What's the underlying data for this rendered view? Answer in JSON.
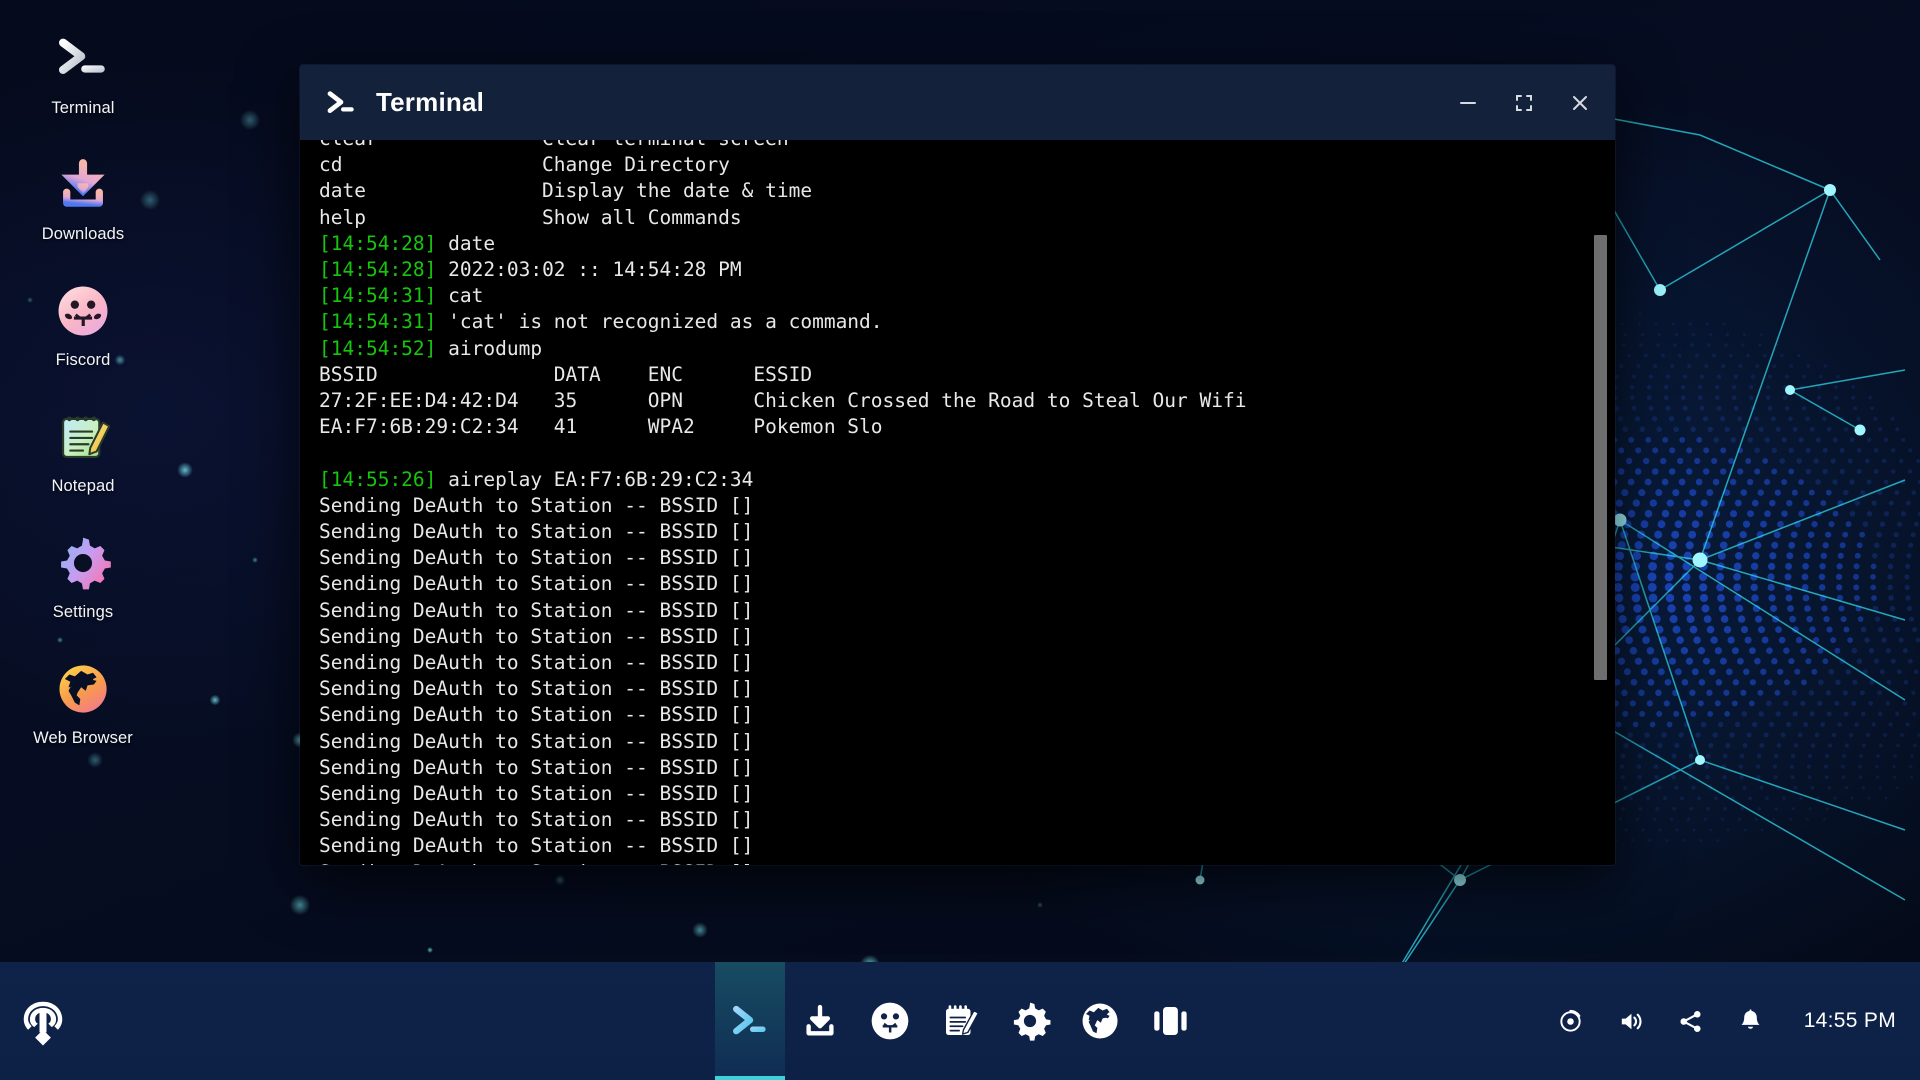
{
  "desktop": {
    "icons": [
      {
        "label": "Terminal",
        "icon": "terminal-prompt-icon"
      },
      {
        "label": "Downloads",
        "icon": "download-arrow-icon"
      },
      {
        "label": "Fiscord",
        "icon": "fiscord-face-icon"
      },
      {
        "label": "Notepad",
        "icon": "notepad-pencil-icon"
      },
      {
        "label": "Settings",
        "icon": "gear-icon"
      },
      {
        "label": "Web Browser",
        "icon": "globe-icon"
      }
    ]
  },
  "terminal": {
    "title": "Terminal",
    "title_icon": "terminal-prompt-icon",
    "controls": {
      "minimize": "minimize-icon",
      "maximize": "maximize-icon",
      "close": "close-icon"
    },
    "lines": [
      {
        "ts": "",
        "text": "clear              Clear terminal screen"
      },
      {
        "ts": "",
        "text": "cd                 Change Directory"
      },
      {
        "ts": "",
        "text": "date               Display the date & time"
      },
      {
        "ts": "",
        "text": "help               Show all Commands"
      },
      {
        "ts": "[14:54:28]",
        "text": " date"
      },
      {
        "ts": "[14:54:28]",
        "text": " 2022:03:02 :: 14:54:28 PM"
      },
      {
        "ts": "[14:54:31]",
        "text": " cat"
      },
      {
        "ts": "[14:54:31]",
        "text": " 'cat' is not recognized as a command."
      },
      {
        "ts": "[14:54:52]",
        "text": " airodump"
      },
      {
        "ts": "",
        "text": "BSSID               DATA    ENC      ESSID"
      },
      {
        "ts": "",
        "text": "27:2F:EE:D4:42:D4   35      OPN      Chicken Crossed the Road to Steal Our Wifi"
      },
      {
        "ts": "",
        "text": "EA:F7:6B:29:C2:34   41      WPA2     Pokemon Slo"
      },
      {
        "ts": "",
        "text": ""
      },
      {
        "ts": "[14:55:26]",
        "text": " aireplay EA:F7:6B:29:C2:34"
      },
      {
        "ts": "",
        "text": "Sending DeAuth to Station -- BSSID []"
      },
      {
        "ts": "",
        "text": "Sending DeAuth to Station -- BSSID []"
      },
      {
        "ts": "",
        "text": "Sending DeAuth to Station -- BSSID []"
      },
      {
        "ts": "",
        "text": "Sending DeAuth to Station -- BSSID []"
      },
      {
        "ts": "",
        "text": "Sending DeAuth to Station -- BSSID []"
      },
      {
        "ts": "",
        "text": "Sending DeAuth to Station -- BSSID []"
      },
      {
        "ts": "",
        "text": "Sending DeAuth to Station -- BSSID []"
      },
      {
        "ts": "",
        "text": "Sending DeAuth to Station -- BSSID []"
      },
      {
        "ts": "",
        "text": "Sending DeAuth to Station -- BSSID []"
      },
      {
        "ts": "",
        "text": "Sending DeAuth to Station -- BSSID []"
      },
      {
        "ts": "",
        "text": "Sending DeAuth to Station -- BSSID []"
      },
      {
        "ts": "",
        "text": "Sending DeAuth to Station -- BSSID []"
      },
      {
        "ts": "",
        "text": "Sending DeAuth to Station -- BSSID []"
      },
      {
        "ts": "",
        "text": "Sending DeAuth to Station -- BSSID []"
      },
      {
        "ts": "",
        "text": "Sending DeAuth to Station -- BSSID []"
      }
    ]
  },
  "taskbar": {
    "start_logo": "system-logo-icon",
    "apps": [
      {
        "name": "Terminal",
        "icon": "terminal-prompt-icon",
        "active": true
      },
      {
        "name": "Downloads",
        "icon": "download-arrow-icon",
        "active": false
      },
      {
        "name": "Fiscord",
        "icon": "fiscord-face-icon",
        "active": false
      },
      {
        "name": "Notepad",
        "icon": "notepad-pencil-icon",
        "active": false
      },
      {
        "name": "Settings",
        "icon": "gear-icon",
        "active": false
      },
      {
        "name": "Web Browser",
        "icon": "globe-icon",
        "active": false
      },
      {
        "name": "Task View",
        "icon": "task-view-icon",
        "active": false
      }
    ],
    "tray": [
      {
        "name": "display-icon"
      },
      {
        "name": "volume-icon"
      },
      {
        "name": "share-icon"
      },
      {
        "name": "notification-bell-icon"
      }
    ],
    "clock": "14:55 PM"
  },
  "colors": {
    "accent_cyan": "#3fd0d8",
    "taskbar_bg": "#0f2348",
    "titlebar_bg": "#13213a",
    "terminal_bg": "#000000",
    "terminal_text": "#e8e8e8",
    "timestamp_green": "#16c60c"
  }
}
